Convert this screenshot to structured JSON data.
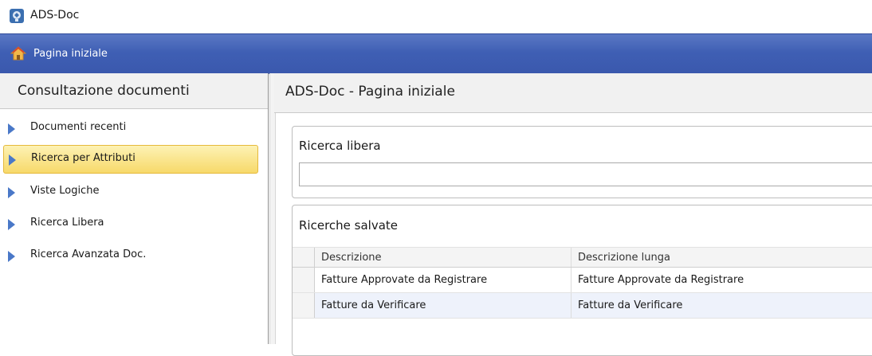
{
  "window": {
    "title": "ADS-Doc"
  },
  "header": {
    "title": "Pagina iniziale"
  },
  "sidebar": {
    "title": "Consultazione documenti",
    "items": [
      {
        "label": "Documenti recenti",
        "selected": false
      },
      {
        "label": "Ricerca per Attributi",
        "selected": true
      },
      {
        "label": "Viste Logiche",
        "selected": false
      },
      {
        "label": "Ricerca Libera",
        "selected": false
      },
      {
        "label": "Ricerca Avanzata Doc.",
        "selected": false
      }
    ]
  },
  "main": {
    "title": "ADS-Doc - Pagina iniziale",
    "free_search": {
      "label": "Ricerca libera",
      "value": ""
    },
    "saved_searches": {
      "label": "Ricerche salvate",
      "columns": [
        "Descrizione",
        "Descrizione lunga"
      ],
      "rows": [
        [
          "Fatture Approvate da Registrare",
          "Fatture Approvate da Registrare"
        ],
        [
          "Fatture da Verificare",
          "Fatture da Verificare"
        ]
      ]
    }
  },
  "colors": {
    "header_blue": "#3f5fb4",
    "selected_item": "#f7d96a",
    "nav_arrow": "#4a78c8",
    "alt_row": "#eef2fb"
  }
}
